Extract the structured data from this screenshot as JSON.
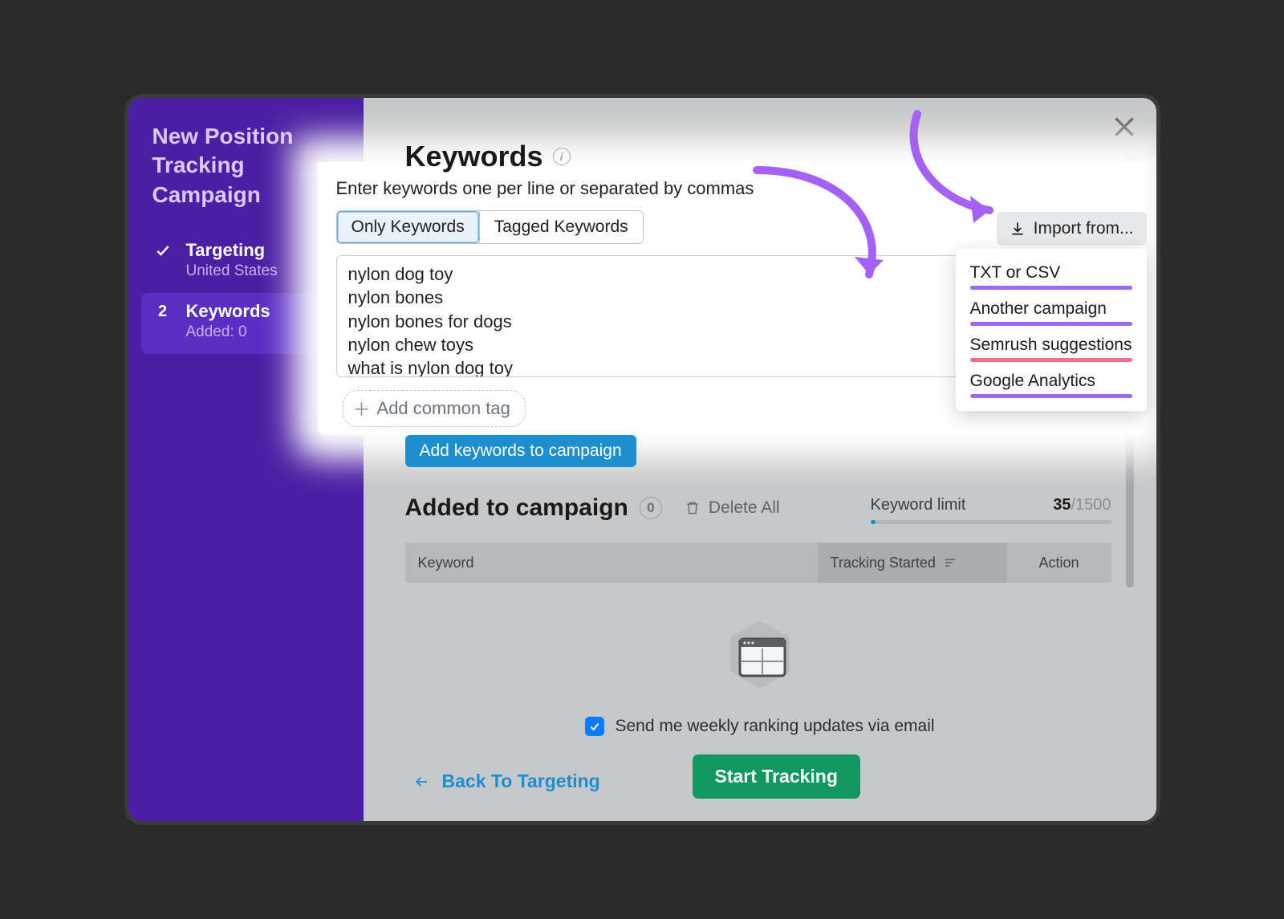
{
  "sidebar": {
    "title": "New Position Tracking Campaign",
    "steps": [
      {
        "label": "Targeting",
        "sub": "United States",
        "done": true
      },
      {
        "num": "2",
        "label": "Keywords",
        "sub": "Added: 0",
        "active": true
      }
    ]
  },
  "header": {
    "title": "Keywords",
    "instruction": "Enter keywords one per line or separated by commas"
  },
  "segments": {
    "only": "Only Keywords",
    "tagged": "Tagged Keywords"
  },
  "import_button": "Import from...",
  "import_menu": [
    {
      "label": "TXT or CSV",
      "underline": "purple"
    },
    {
      "label": "Another campaign",
      "underline": "purple"
    },
    {
      "label": "Semrush suggestions",
      "underline": "pink"
    },
    {
      "label": "Google Analytics",
      "underline": "purple"
    }
  ],
  "keywords_input": [
    "nylon dog toy",
    "nylon bones",
    "nylon bones for dogs",
    "nylon chew toys",
    "what is nylon dog toy"
  ],
  "add_tag": "Add common tag",
  "add_to_campaign_btn": "Add keywords to campaign",
  "added": {
    "heading": "Added to campaign",
    "count": "0",
    "delete_all": "Delete All",
    "limit_label": "Keyword limit",
    "limit_used": "35",
    "limit_max": "/1500"
  },
  "table": {
    "col_keyword": "Keyword",
    "col_tracking": "Tracking Started",
    "col_action": "Action"
  },
  "footer": {
    "weekly": "Send me weekly ranking updates via email",
    "back": "Back To Targeting",
    "start": "Start Tracking"
  }
}
